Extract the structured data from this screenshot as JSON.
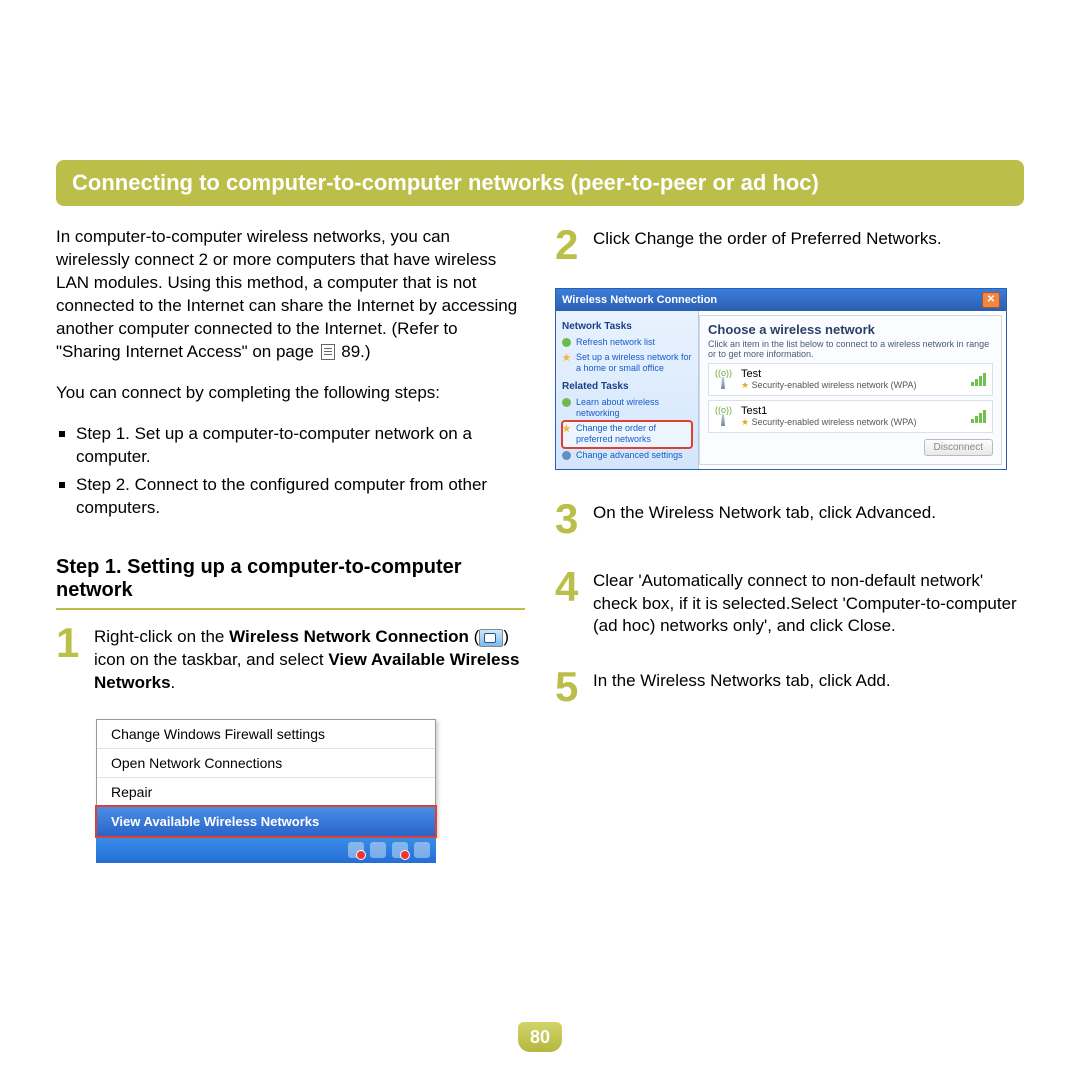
{
  "banner": "Connecting to computer-to-computer networks (peer-to-peer or ad hoc)",
  "left": {
    "intro_a": "In computer-to-computer wireless networks, you can wirelessly connect 2 or more computers that have wireless LAN modules. Using this method, a computer that is not connected to the Internet can share the Internet by accessing another computer connected to the Internet. (Refer to \"Sharing Internet Access\" on page ",
    "intro_ref": "89.)",
    "connect_by": "You can connect by completing the following steps:",
    "b1": "Step 1. Set up a computer-to-computer network on a computer.",
    "b2": "Step 2. Connect to the configured computer from other computers.",
    "step_header": "Step 1. Setting up a computer-to-computer network",
    "s1_a": "Right-click on the ",
    "s1_b": "Wireless Network Connection",
    "s1_c": " (",
    "s1_d": ") icon on the taskbar, and select ",
    "s1_e": "View Available Wireless Networks",
    "s1_f": "."
  },
  "ctxmenu": {
    "i1": "Change Windows Firewall settings",
    "i2": "Open Network Connections",
    "i3": "Repair",
    "i4": "View Available Wireless Networks"
  },
  "right": {
    "s2": "Click Change the order of Preferred Networks.",
    "s3": "On the Wireless Network tab, click Advanced.",
    "s4": "Clear 'Automatically connect to non-default network' check box, if it is selected.Select 'Computer-to-computer (ad hoc) networks only', and click Close.",
    "s5": "In the Wireless Networks tab, click Add."
  },
  "dlg": {
    "title": "Wireless Network Connection",
    "tasks_h": "Network Tasks",
    "t1": "Refresh network list",
    "t2": "Set up a wireless network for a home or small office",
    "related_h": "Related Tasks",
    "r1": "Learn about wireless networking",
    "r2": "Change the order of preferred networks",
    "r3": "Change advanced settings",
    "main_h": "Choose a wireless network",
    "main_s": "Click an item in the list below to connect to a wireless network in range or to get more information.",
    "n1": "Test",
    "n1d": "Security-enabled wireless network (WPA)",
    "n2": "Test1",
    "n2d": "Security-enabled wireless network (WPA)",
    "btn": "Disconnect"
  },
  "pagenum": "80"
}
